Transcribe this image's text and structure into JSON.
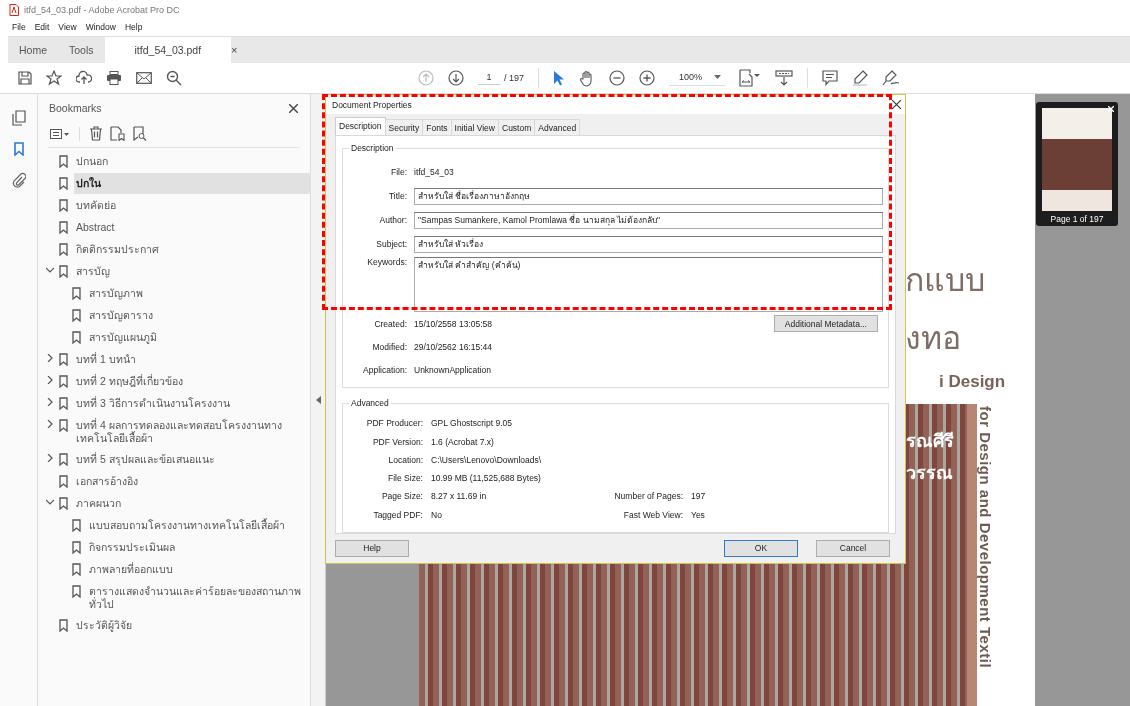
{
  "window": {
    "title": "itfd_54_03.pdf - Adobe Acrobat Pro DC"
  },
  "menu": [
    "File",
    "Edit",
    "View",
    "Window",
    "Help"
  ],
  "tabs": [
    {
      "label": "Home",
      "selected": false,
      "kind": "nav"
    },
    {
      "label": "Tools",
      "selected": false,
      "kind": "nav"
    },
    {
      "label": "itfd_54_03.pdf",
      "selected": true,
      "kind": "document",
      "close": "×"
    }
  ],
  "toolbar": {
    "prev_disabled": true,
    "page": "1",
    "page_total": "/ 197",
    "zoom": "100%"
  },
  "bookmarks": {
    "title": "Bookmarks",
    "items": [
      {
        "label": "ปกนอก",
        "kind": "leaf",
        "selected": false
      },
      {
        "label": "ปกใน",
        "kind": "leaf",
        "selected": true
      },
      {
        "label": "บทคัดย่อ",
        "kind": "leaf",
        "selected": false
      },
      {
        "label": "Abstract",
        "kind": "leaf",
        "selected": false
      },
      {
        "label": "กิตติกรรมประกาศ",
        "kind": "leaf",
        "selected": false
      },
      {
        "label": "สารบัญ",
        "kind": "branch",
        "expanded": true,
        "selected": false,
        "children": [
          {
            "label": "สารบัญภาพ",
            "selected": false
          },
          {
            "label": "สารบัญตาราง",
            "selected": false
          },
          {
            "label": "สารบัญแผนภูมิ",
            "selected": false
          }
        ]
      },
      {
        "label": "บทที่ 1 บทนำ",
        "kind": "branch",
        "expanded": false,
        "selected": false
      },
      {
        "label": "บทที่ 2 ทฤษฎีที่เกี่ยวข้อง",
        "kind": "branch",
        "expanded": false,
        "selected": false
      },
      {
        "label": "บทที่ 3 วิธีการดำเนินงานโครงงาน",
        "kind": "branch",
        "expanded": false,
        "selected": false
      },
      {
        "label": "บทที่ 4 ผลการทดลองและทดสอบโครงงานทางเทคโนโลยีเสื้อผ้า",
        "kind": "branch",
        "expanded": false,
        "selected": false
      },
      {
        "label": "บทที่ 5 สรุปผลและข้อเสนอแนะ",
        "kind": "branch",
        "expanded": false,
        "selected": false
      },
      {
        "label": "เอกสารอ้างอิง",
        "kind": "leaf",
        "selected": false
      },
      {
        "label": "ภาคผนวก",
        "kind": "branch",
        "expanded": true,
        "selected": false,
        "children": [
          {
            "label": "แบบสอบถามโครงงานทางเทคโนโลยีเสื้อผ้า",
            "selected": false
          },
          {
            "label": "กิจกรรมประเมินผล",
            "selected": false
          },
          {
            "label": "ภาพลายที่ออกแบบ",
            "selected": false
          },
          {
            "label": "ตารางแสดงจำนวนและค่าร้อยละของสถานภาพทั่วไป",
            "selected": false
          }
        ]
      },
      {
        "label": "ประวัติผู้วิจัย",
        "kind": "leaf",
        "selected": false
      }
    ]
  },
  "page": {
    "heading_1": "กแบบ",
    "heading_2": "งทอ",
    "subtitle": "i Design",
    "photo_line_1": "รณศีรี",
    "photo_line_2": "วรรณ",
    "side_text": "for Design and Development Textil"
  },
  "thumbnail": {
    "caption": "Page 1 of 197"
  },
  "dialog": {
    "title": "Document Properties",
    "tabs": [
      {
        "label": "Description",
        "selected": true
      },
      {
        "label": "Security",
        "selected": false
      },
      {
        "label": "Fonts",
        "selected": false
      },
      {
        "label": "Initial View",
        "selected": false
      },
      {
        "label": "Custom",
        "selected": false
      },
      {
        "label": "Advanced",
        "selected": false
      }
    ],
    "description": {
      "legend": "Description",
      "file_label": "File:",
      "file": "itfd_54_03",
      "fields": [
        {
          "label": "Title:",
          "value": "สำหรับใส่ ชื่อเรื่องภาษาอังกฤษ",
          "kind": "line"
        },
        {
          "label": "Author:",
          "value": "\"Sampas Sumankere, Kamol Promlawa ชื่อ นามสกุล ไม่ต้องกลับ\"",
          "kind": "line"
        },
        {
          "label": "Subject:",
          "value": "สำหรับใส่ หัวเรื่อง",
          "kind": "line"
        },
        {
          "label": "Keywords:",
          "value": "สำหรับใส่ คำสำคัญ (คำค้น)",
          "kind": "area"
        }
      ],
      "info": [
        {
          "label": "Created:",
          "value": "15/10/2558 13:05:58"
        },
        {
          "label": "Modified:",
          "value": "29/10/2562 16:15:44"
        },
        {
          "label": "Application:",
          "value": "UnknownApplication"
        }
      ],
      "metadata_button": "Additional Metadata..."
    },
    "advanced": {
      "legend": "Advanced",
      "rows": [
        [
          {
            "label": "PDF Producer:",
            "value": "GPL Ghostscript 9.05"
          }
        ],
        [
          {
            "label": "PDF Version:",
            "value": "1.6 (Acrobat 7.x)"
          }
        ],
        [
          {
            "label": "Location:",
            "value": "C:\\Users\\Lenovo\\Downloads\\"
          }
        ],
        [
          {
            "label": "File Size:",
            "value": "10.99 MB (11,525,688 Bytes)"
          }
        ],
        [
          {
            "label": "Page Size:",
            "value": "8.27 x 11.69 in"
          },
          {
            "label": "Number of Pages:",
            "value": "197"
          }
        ],
        [
          {
            "label": "Tagged PDF:",
            "value": "No"
          },
          {
            "label": "Fast Web View:",
            "value": "Yes"
          }
        ]
      ]
    },
    "buttons": {
      "help": "Help",
      "ok": "OK",
      "cancel": "Cancel"
    }
  }
}
